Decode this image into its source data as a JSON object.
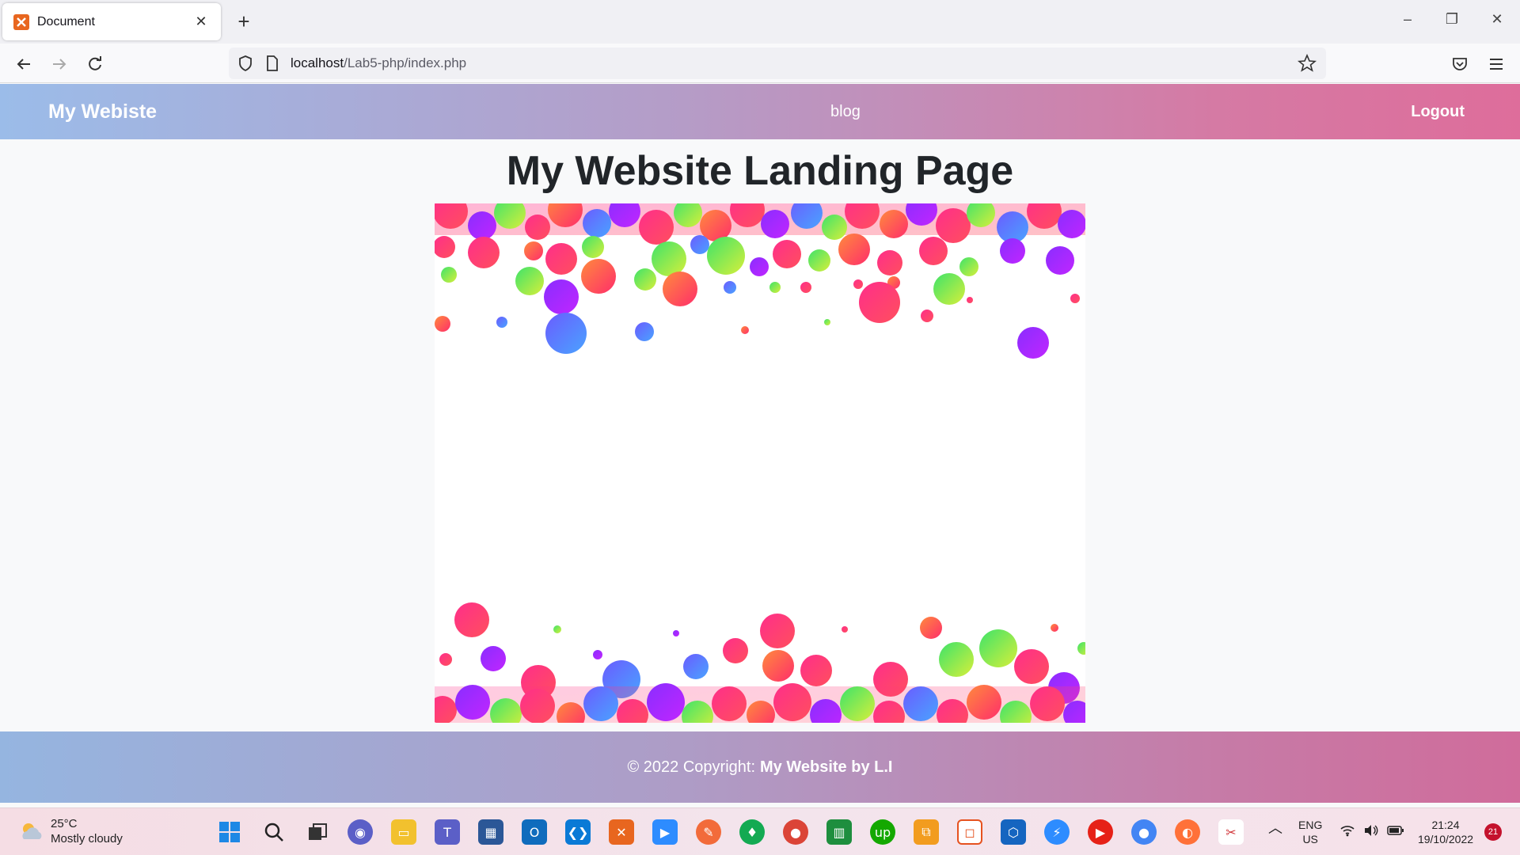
{
  "browser": {
    "tab_title": "Document",
    "new_tab": "+",
    "url_host": "localhost",
    "url_path": "/Lab5-php/index.php"
  },
  "site": {
    "brand": "My Webiste",
    "nav_link": "blog",
    "logout": "Logout",
    "page_title": "My Website Landing Page",
    "footer_prefix": "© 2022 Copyright:",
    "footer_owner": "My Website by L.I"
  },
  "taskbar": {
    "weather_temp": "25°C",
    "weather_desc": "Mostly cloudy",
    "lang": "ENG",
    "region": "US",
    "time": "21:24",
    "date": "19/10/2022",
    "notifications": "21"
  },
  "colors": {
    "header_left": "#9bbce9",
    "header_right": "#de6d9b"
  }
}
